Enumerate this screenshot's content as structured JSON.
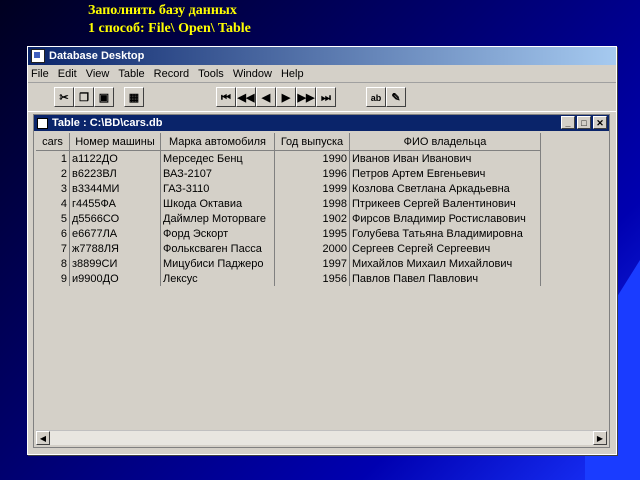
{
  "slide": {
    "title_line1": "Заполнить базу данных",
    "title_line2": "1 способ: File\\ Open\\ Table"
  },
  "app": {
    "title": "Database Desktop",
    "menu": [
      "File",
      "Edit",
      "View",
      "Table",
      "Record",
      "Tools",
      "Window",
      "Help"
    ],
    "toolbar_icons": [
      "scissors-icon",
      "copy-icon",
      "paste-icon",
      "grid-icon",
      "first-record-icon",
      "prev-set-icon",
      "prev-record-icon",
      "next-record-icon",
      "next-set-icon",
      "last-record-icon",
      "field-view-icon",
      "edit-data-icon"
    ]
  },
  "table_window": {
    "title": "Table : C:\\BD\\cars.db",
    "columns": [
      "cars",
      "Номер машины",
      "Марка автомобиля",
      "Год выпуска",
      "ФИО владельца"
    ],
    "rows": [
      [
        "1",
        "а1122ДО",
        "Мерседес Бенц",
        "1990",
        "Иванов Иван Иванович"
      ],
      [
        "2",
        "в6223ВЛ",
        "ВАЗ-2107",
        "1996",
        "Петров Артем Евгеньевич"
      ],
      [
        "3",
        "в3344МИ",
        "ГАЗ-3110",
        "1999",
        "Козлова Светлана Аркадьевна"
      ],
      [
        "4",
        "г4455ФА",
        "Шкода Октавиа",
        "1998",
        "Птрикеев Сергей Валентинович"
      ],
      [
        "5",
        "д5566СО",
        "Даймлер Моторваге",
        "1902",
        "Фирсов Владимир Ростиславович"
      ],
      [
        "6",
        "е6677ЛА",
        "Форд Эскорт",
        "1995",
        "Голубева Татьяна Владимировна"
      ],
      [
        "7",
        "ж7788ЛЯ",
        "Фольксваген Пасса",
        "2000",
        "Сергеев Сергей Сергеевич"
      ],
      [
        "8",
        "з8899СИ",
        "Мицубиси Паджеро",
        "1997",
        "Михайлов Михаил Михайлович"
      ],
      [
        "9",
        "и9900ДО",
        "Лексус",
        "1956",
        "Павлов Павел Павлович"
      ]
    ]
  }
}
